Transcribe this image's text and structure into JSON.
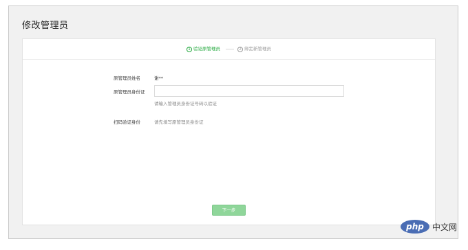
{
  "page": {
    "title": "修改管理员"
  },
  "steps": [
    {
      "num": "1",
      "label": "验证原管理员",
      "active": true
    },
    {
      "num": "2",
      "label": "绑定新管理员",
      "active": false
    }
  ],
  "form": {
    "name_label": "原管理员姓名",
    "name_value": "谢**",
    "id_label": "原管理员身份证",
    "id_value": "",
    "id_placeholder": "",
    "id_hint": "请输入管理员身份证号码以验证",
    "scan_label": "扫码验证身份",
    "scan_hint": "请先填写原管理员身份证"
  },
  "actions": {
    "next_label": "下一步"
  },
  "watermark": {
    "logo": "php",
    "text": "中文网"
  },
  "colors": {
    "accent": "#22a83c",
    "button": "#8fd69a",
    "frame_bg": "#f1f1f1"
  }
}
